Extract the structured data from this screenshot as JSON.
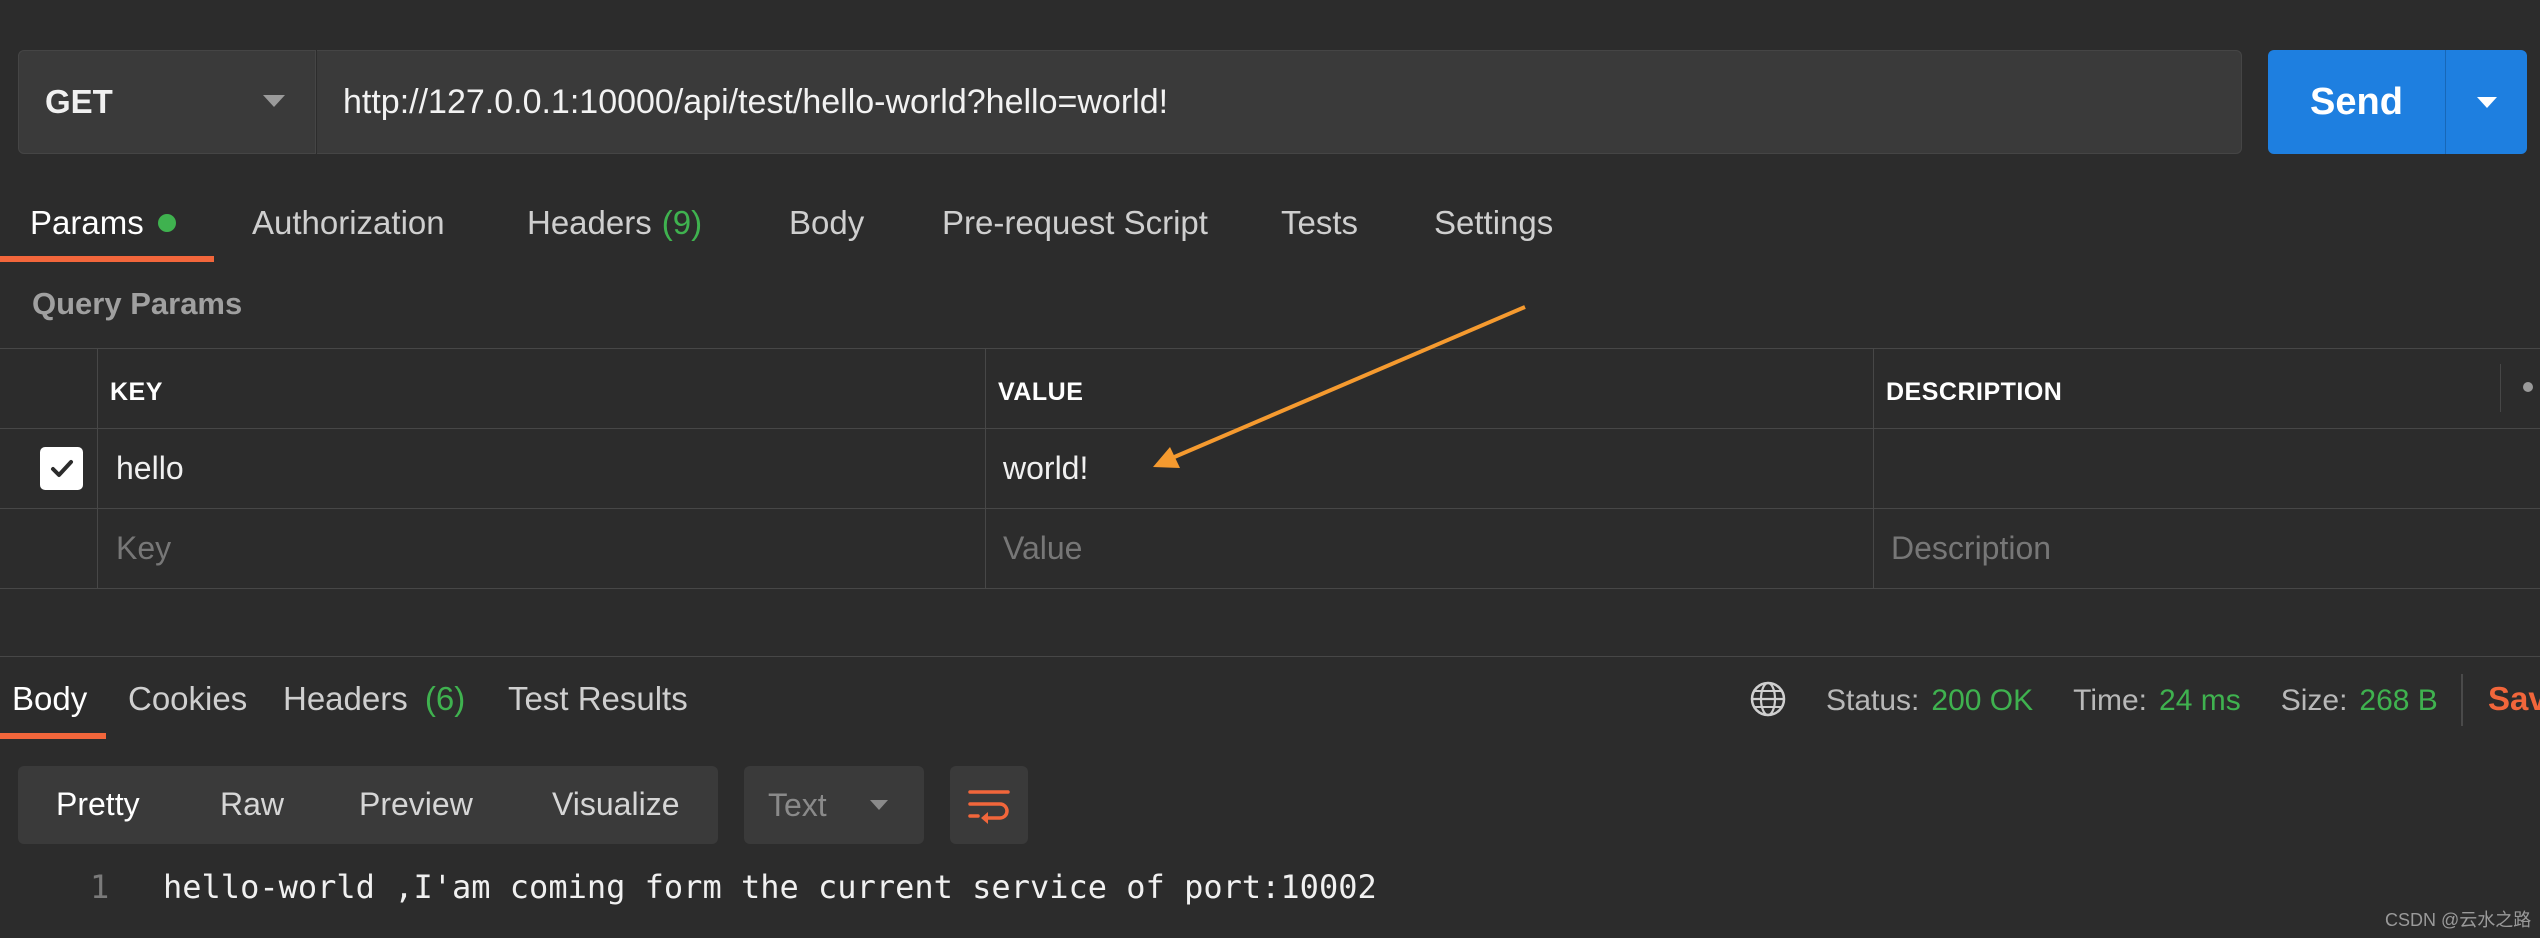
{
  "request": {
    "method": "GET",
    "url": "http://127.0.0.1:10000/api/test/hello-world?hello=world!",
    "send_label": "Send"
  },
  "request_tabs": [
    {
      "label": "Params",
      "active": true,
      "indicator": "green-dot"
    },
    {
      "label": "Authorization"
    },
    {
      "label": "Headers",
      "count": "(9)"
    },
    {
      "label": "Body"
    },
    {
      "label": "Pre-request Script"
    },
    {
      "label": "Tests"
    },
    {
      "label": "Settings"
    }
  ],
  "query_params": {
    "title": "Query Params",
    "columns": [
      "KEY",
      "VALUE",
      "DESCRIPTION"
    ],
    "rows": [
      {
        "checked": true,
        "key": "hello",
        "value": "world!",
        "description": ""
      }
    ],
    "placeholder": {
      "key": "Key",
      "value": "Value",
      "description": "Description"
    }
  },
  "response_tabs": [
    {
      "label": "Body",
      "active": true
    },
    {
      "label": "Cookies"
    },
    {
      "label": "Headers",
      "count": "(6)"
    },
    {
      "label": "Test Results"
    }
  ],
  "response_meta": {
    "status_label": "Status:",
    "status_value": "200 OK",
    "time_label": "Time:",
    "time_value": "24 ms",
    "size_label": "Size:",
    "size_value": "268 B",
    "save_label": "Sav"
  },
  "view_modes": [
    "Pretty",
    "Raw",
    "Preview",
    "Visualize"
  ],
  "format": "Text",
  "response_body": {
    "line_number": "1",
    "text": "hello-world ,I'am coming form the current service of port:10002"
  },
  "watermark": "CSDN @云水之路",
  "colors": {
    "accent_orange": "#f2663b",
    "send_blue": "#1e7fe0",
    "success_green": "#3fb24f",
    "annotation_arrow": "#f59a2f"
  },
  "icons": [
    "chevron-down-icon",
    "checkmark-icon",
    "globe-icon",
    "wrap-lines-icon",
    "annotation-arrow"
  ]
}
